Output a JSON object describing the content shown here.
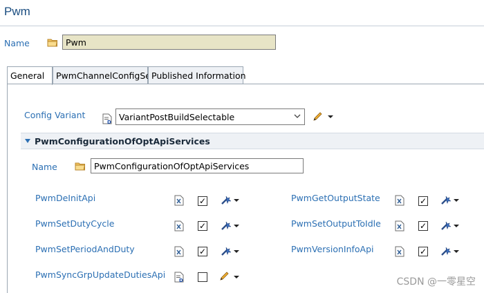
{
  "header": {
    "title": "Pwm"
  },
  "name_row": {
    "label": "Name",
    "value": "Pwm"
  },
  "tabs": [
    {
      "label": "General"
    },
    {
      "label": "PwmChannelConfigSet"
    },
    {
      "label": "Published Information"
    }
  ],
  "config_variant": {
    "label": "Config Variant",
    "value": "VariantPostBuildSelectable"
  },
  "section": {
    "title": "PwmConfigurationOfOptApiServices",
    "name_label": "Name",
    "name_value": "PwmConfigurationOfOptApiServices"
  },
  "params": [
    {
      "label": "PwmDeInitApi",
      "checked": true
    },
    {
      "label": "PwmSetDutyCycle",
      "checked": true
    },
    {
      "label": "PwmSetPeriodAndDuty",
      "checked": true
    },
    {
      "label": "PwmSyncGrpUpdateDutiesApi",
      "checked": false
    },
    {
      "label": "PwmGetOutputState",
      "checked": true
    },
    {
      "label": "PwmSetOutputToIdle",
      "checked": true
    },
    {
      "label": "PwmVersionInfoApi",
      "checked": true
    }
  ],
  "watermark": "CSDN @一零星空",
  "colors": {
    "label_blue": "#2b6fb3",
    "title_blue": "#1a4d80",
    "name_field_bg": "#e7e4c6"
  }
}
